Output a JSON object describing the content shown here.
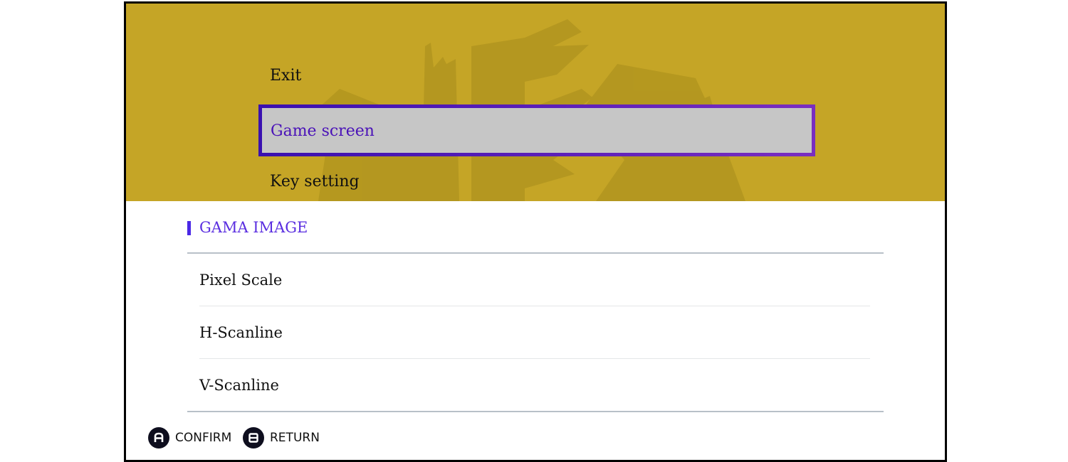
{
  "colors": {
    "top_panel_bg": "#c5a526",
    "selected_bg": "#c6c6c6",
    "selected_border": "#3a10b0",
    "accent": "#5a2ee0",
    "text": "#111111"
  },
  "menu": {
    "items": [
      {
        "label": "Exit",
        "selected": false
      },
      {
        "label": "Game screen",
        "selected": true
      },
      {
        "label": "Key setting",
        "selected": false
      }
    ]
  },
  "section": {
    "title": "GAMA IMAGE",
    "options": [
      {
        "label": "Pixel Scale"
      },
      {
        "label": "H-Scanline"
      },
      {
        "label": "V-Scanline"
      }
    ]
  },
  "footer": {
    "confirm": {
      "icon": "a-button-icon",
      "label": "CONFIRM"
    },
    "return": {
      "icon": "b-button-icon",
      "label": "RETURN"
    }
  }
}
